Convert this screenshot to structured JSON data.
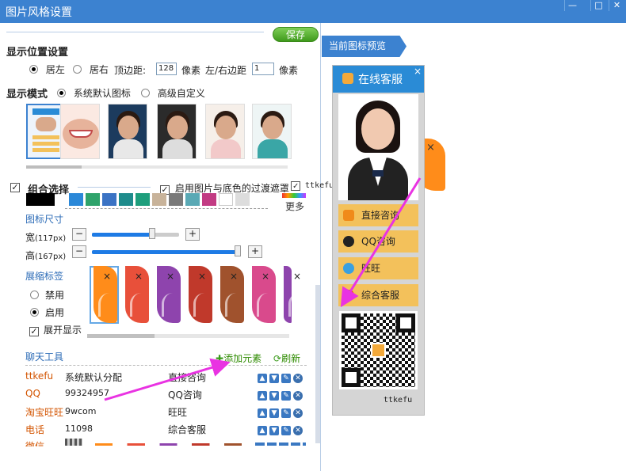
{
  "window": {
    "title": "图片风格设置",
    "buttons": [
      "—",
      "□",
      "✕"
    ]
  },
  "toolbar": {
    "save": "保存"
  },
  "position": {
    "label": "显示位置设置",
    "left": "居左",
    "right": "居右",
    "top_label": "顶边距:",
    "top_value": "128",
    "unit": "像素",
    "side_label": "左/右边距",
    "side_value": "1",
    "unit2": "像素"
  },
  "mode": {
    "label": "显示模式",
    "default": "系统默认图标",
    "advanced": "高级自定义"
  },
  "combo": {
    "label": "组合选择",
    "filter_label": "启用图片与底色的过渡遮罩",
    "ttkefu": "ttkefu",
    "more": "更多",
    "colors": [
      "#000000",
      "#2b88d8",
      "#2fa36b",
      "#3b73c4",
      "#1f8c8c",
      "#1e9e7c",
      "#c8b39a",
      "#7a7a7a",
      "#5aa9b5",
      "#c23b83",
      "#ffffff",
      "#dddddd"
    ]
  },
  "size": {
    "label": "图标尺寸",
    "width_label": "宽",
    "width_val": "(117px)",
    "height_label": "高",
    "height_val": "(167px)",
    "width_fraction": 0.69,
    "height_fraction": 0.98
  },
  "tabs": {
    "label": "展缩标签",
    "disable": "禁用",
    "enable": "启用",
    "expand": "展开显示",
    "tab_colors": [
      "#ff8c1a",
      "#e8503a",
      "#8e44ad",
      "#c0392b",
      "#a0522d",
      "#d94a8c",
      "#8e44ad"
    ]
  },
  "chat": {
    "label": "聊天工具",
    "add": "添加元素",
    "refresh": "刷新",
    "rows": [
      {
        "type": "ttkefu",
        "value": "系统默认分配",
        "name": "直接咨询"
      },
      {
        "type": "QQ",
        "value": "99324957",
        "name": "QQ咨询"
      },
      {
        "type": "淘宝旺旺",
        "value": "9wcom",
        "name": "旺旺"
      },
      {
        "type": "电话",
        "value": "11098",
        "name": "综合客服"
      },
      {
        "type": "微信",
        "value": "",
        "name": ""
      }
    ]
  },
  "preview": {
    "tab": "当前图标预览",
    "header": "在线客服",
    "close": "×",
    "buttons": [
      "直接咨询",
      "QQ咨询",
      "旺旺",
      "综合客服"
    ],
    "footer": "ttkefu"
  },
  "overlay": {
    "arrow_color": "#e933e2"
  }
}
